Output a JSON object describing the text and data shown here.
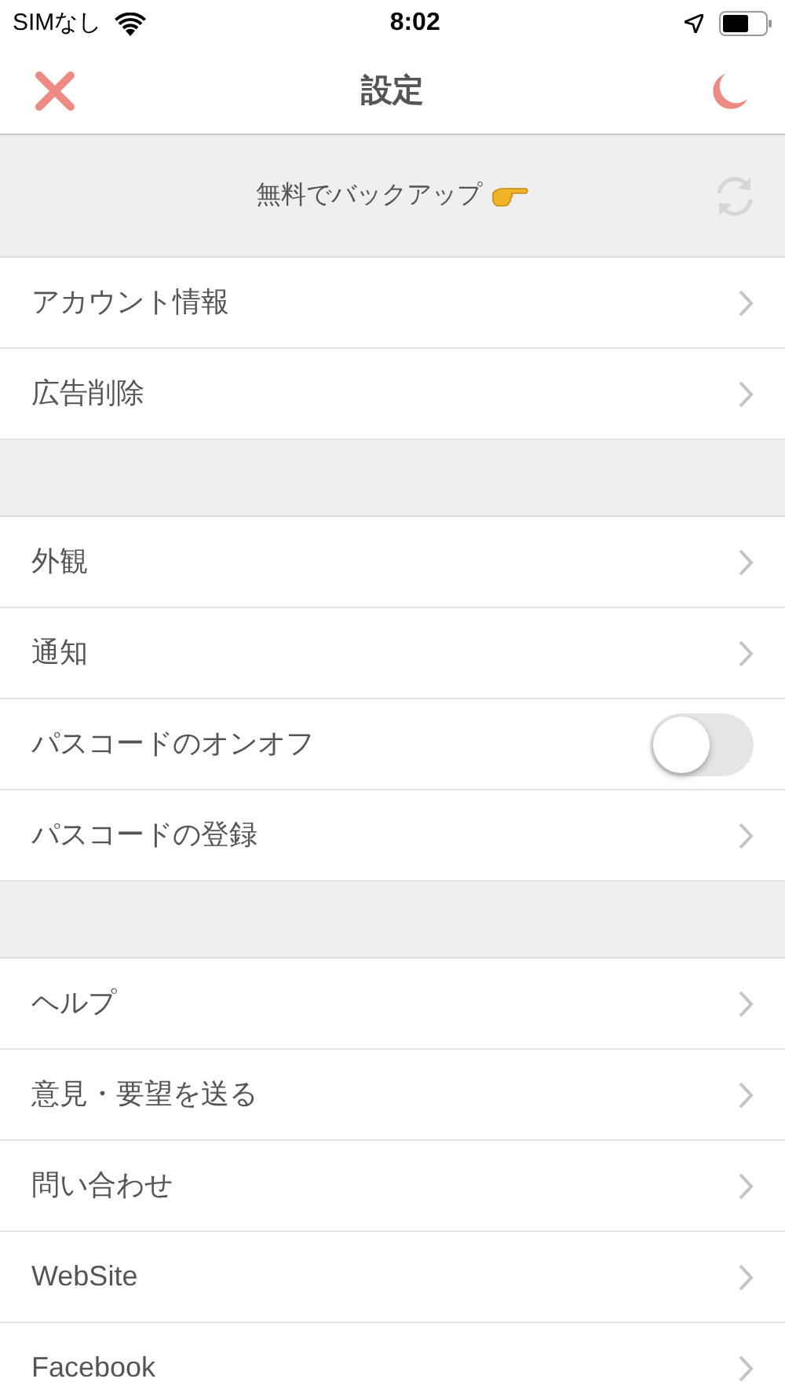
{
  "status_bar": {
    "carrier": "SIMなし",
    "time": "8:02"
  },
  "nav": {
    "title": "設定"
  },
  "backup": {
    "label": "無料でバックアップ"
  },
  "sections": [
    {
      "items": [
        {
          "kind": "link",
          "label": "アカウント情報"
        },
        {
          "kind": "link",
          "label": "広告削除"
        }
      ]
    },
    {
      "items": [
        {
          "kind": "link",
          "label": "外観"
        },
        {
          "kind": "link",
          "label": "通知"
        },
        {
          "kind": "toggle",
          "label": "パスコードのオンオフ",
          "on": false
        },
        {
          "kind": "link",
          "label": "パスコードの登録"
        }
      ]
    },
    {
      "items": [
        {
          "kind": "link",
          "label": "ヘルプ"
        },
        {
          "kind": "link",
          "label": "意見・要望を送る"
        },
        {
          "kind": "link",
          "label": "問い合わせ"
        },
        {
          "kind": "link",
          "label": "WebSite"
        },
        {
          "kind": "link",
          "label": "Facebook"
        }
      ]
    }
  ]
}
